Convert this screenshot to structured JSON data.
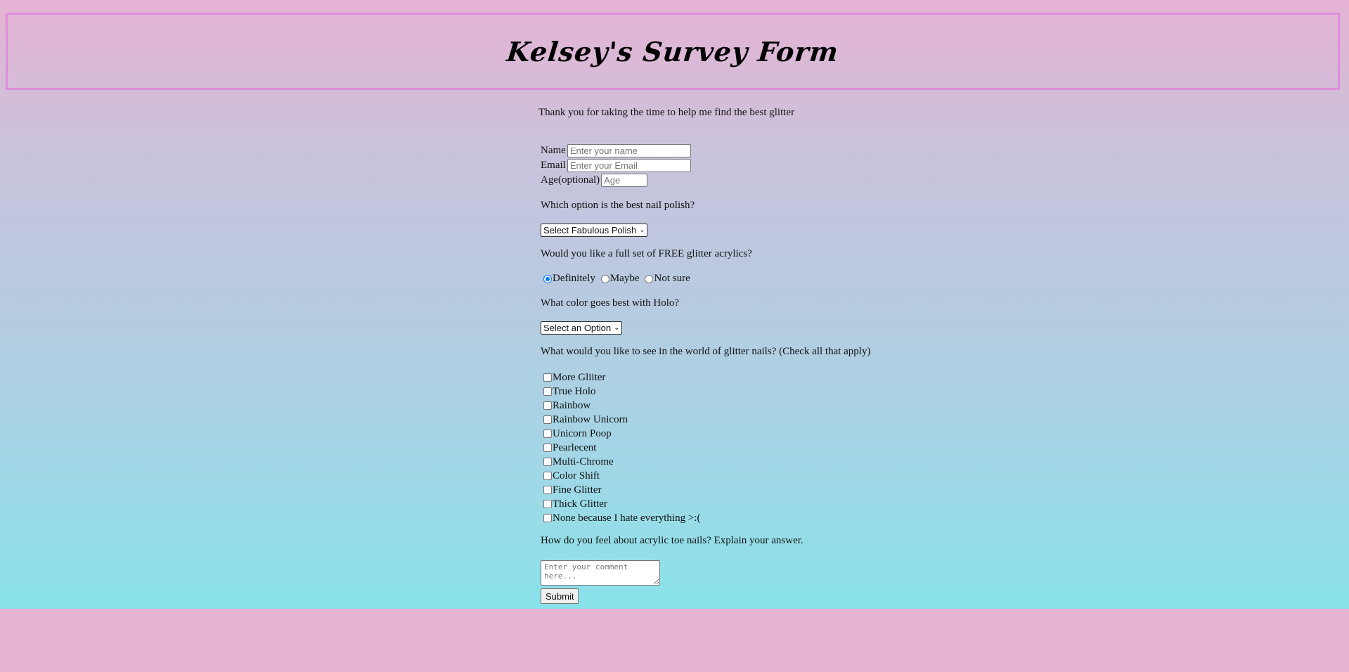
{
  "header": {
    "title": "Kelsey's Survey Form"
  },
  "intro": "Thank you for taking the time to help me find the best glitter",
  "fields": {
    "name_label": "Name",
    "name_placeholder": "Enter your name",
    "email_label": "Email",
    "email_placeholder": "Enter your Email",
    "age_label": "Age(optional)",
    "age_placeholder": "Age"
  },
  "q_polish": {
    "question": "Which option is the best nail polish?",
    "selected": "Select Fabulous Polish"
  },
  "q_acrylics": {
    "question": "Would you like a full set of FREE glitter acrylics?",
    "options": [
      "Definitely",
      "Maybe",
      "Not sure"
    ],
    "selected": "Definitely"
  },
  "q_holo": {
    "question": "What color goes best with Holo?",
    "selected": "Select an Option"
  },
  "q_world": {
    "question": "What would you like to see in the world of glitter nails? (Check all that apply)",
    "options": [
      "More Gliiter",
      "True Holo",
      "Rainbow",
      "Rainbow Unicorn",
      "Unicorn Poop",
      "Pearlecent",
      "Multi-Chrome",
      "Color Shift",
      "Fine Glitter",
      "Thick Glitter",
      "None because I hate everything >:("
    ]
  },
  "q_toe": {
    "question": "How do you feel about acrylic toe nails? Explain your answer.",
    "placeholder": "Enter your comment here..."
  },
  "submit_label": "Submit"
}
